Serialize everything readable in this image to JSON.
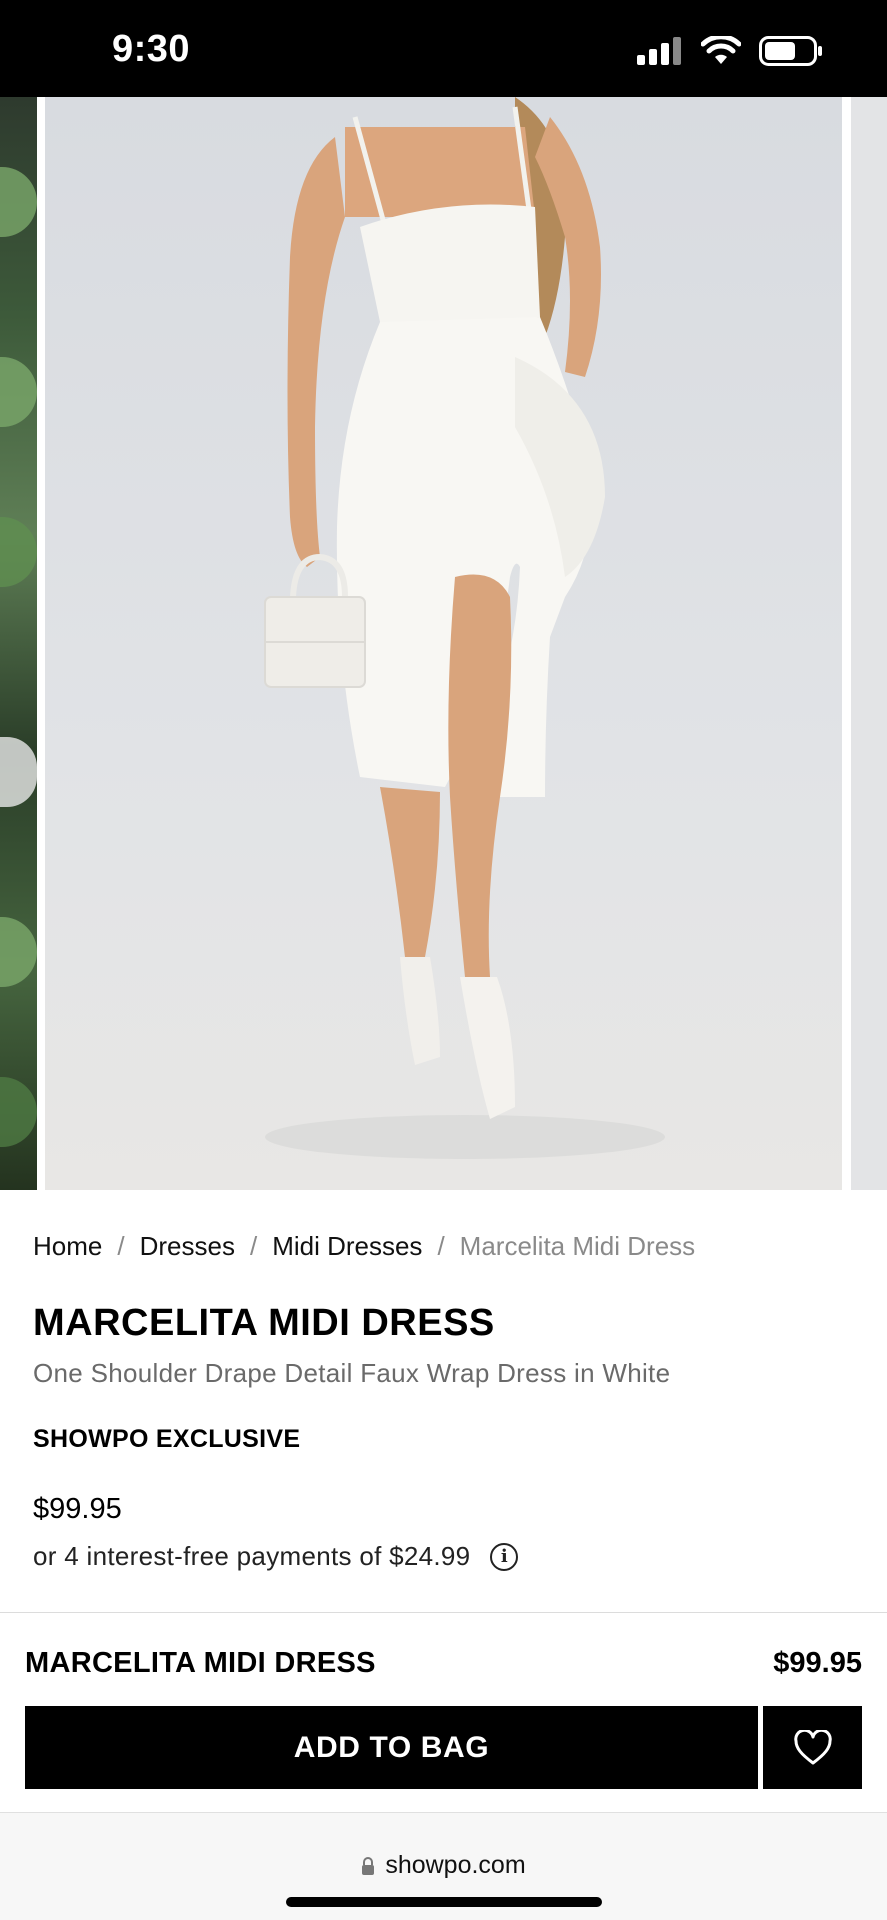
{
  "status_bar": {
    "time": "9:30",
    "icons": [
      "signal-icon",
      "wifi-icon",
      "battery-icon"
    ]
  },
  "carousel": {
    "images": [
      "previous-product-photo",
      "marcelita-midi-dress-photo",
      "next-product-photo"
    ]
  },
  "breadcrumb": {
    "items": [
      "Home",
      "Dresses",
      "Midi Dresses",
      "Marcelita Midi Dress"
    ],
    "separator": "/"
  },
  "product": {
    "title": "MARCELITA MIDI DRESS",
    "subtitle": "One Shoulder Drape Detail Faux Wrap Dress in White",
    "badge": "SHOWPO EXCLUSIVE",
    "price": "$99.95",
    "installments": "or 4 interest-free payments of $24.99"
  },
  "sticky_bar": {
    "title": "MARCELITA MIDI DRESS",
    "price": "$99.95",
    "add_label": "ADD TO BAG"
  },
  "browser": {
    "url": "showpo.com"
  },
  "colors": {
    "primary": "#000000",
    "muted_text": "#8a8a8a",
    "background": "#ffffff"
  }
}
